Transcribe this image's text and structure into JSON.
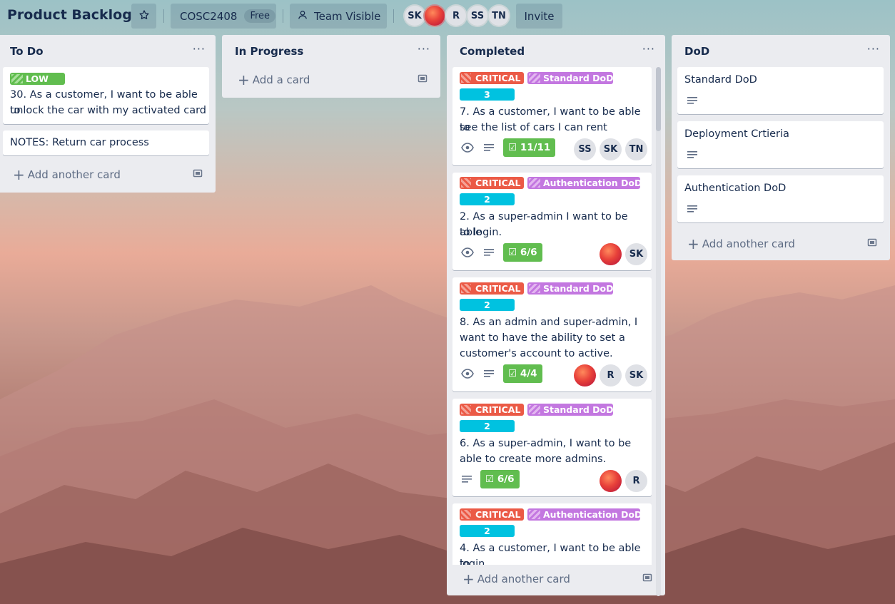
{
  "board": {
    "title": "Product Backlog",
    "workspace": "COSC2408",
    "plan": "Free",
    "visibility": "Team Visible",
    "invite": "Invite",
    "members": [
      "SK",
      "",
      "R",
      "SS",
      "TN"
    ]
  },
  "icons": {
    "star": "star-icon",
    "visibility": "team-visible-icon",
    "watch": "eye-icon",
    "description": "description-icon",
    "checklist": "checklist-icon",
    "template": "card-template-icon",
    "more": "more-horizontal-icon"
  },
  "colors": {
    "critical": "#eb5a46",
    "dod": "#c377e0",
    "low": "#61bd4f",
    "points": "#00c2e0",
    "checklist_done": "#61bd4f"
  },
  "lists": {
    "todo": {
      "title": "To Do",
      "menu": "···",
      "add": "Add another card",
      "cards": [
        {
          "label": "LOW",
          "text_1": "30. As a customer, I want to be able to",
          "text_2": "unlock the car with my activated card"
        },
        {
          "text": "NOTES: Return car process"
        }
      ]
    },
    "inprogress": {
      "title": "In Progress",
      "menu": "···",
      "add": "Add a card"
    },
    "completed": {
      "title": "Completed",
      "menu": "···",
      "add": "Add another card",
      "cards": [
        {
          "labels": [
            "CRITICAL",
            "Standard DoD"
          ],
          "points": "3",
          "lines": [
            "7. As a customer, I want to be able to",
            "see the list of cars I can rent"
          ],
          "checklist": "11/11",
          "members": [
            "SS",
            "SK",
            "TN"
          ]
        },
        {
          "labels": [
            "CRITICAL",
            "Authentication DoD"
          ],
          "points": "2",
          "lines": [
            "2. As a super-admin I want to be able",
            "to login."
          ],
          "checklist": "6/6",
          "members": [
            "",
            "SK"
          ]
        },
        {
          "labels": [
            "CRITICAL",
            "Standard DoD"
          ],
          "points": "2",
          "lines": [
            "8. As an admin and super-admin, I",
            "want to have the ability to set a",
            "customer's account to active."
          ],
          "checklist": "4/4",
          "members": [
            "",
            "R",
            "SK"
          ]
        },
        {
          "labels": [
            "CRITICAL",
            "Standard DoD"
          ],
          "points": "2",
          "lines": [
            "6. As a super-admin, I want to be",
            "able to create more admins."
          ],
          "checklist": "6/6",
          "members": [
            "",
            "R"
          ]
        },
        {
          "labels": [
            "CRITICAL",
            "Authentication DoD"
          ],
          "points": "2",
          "lines": [
            "4. As a customer, I want to be able to",
            "login."
          ]
        }
      ]
    },
    "dod": {
      "title": "DoD",
      "menu": "···",
      "add": "Add another card",
      "cards": [
        {
          "text": "Standard DoD"
        },
        {
          "text": "Deployment Crtieria"
        },
        {
          "text": "Authentication DoD"
        }
      ]
    }
  }
}
